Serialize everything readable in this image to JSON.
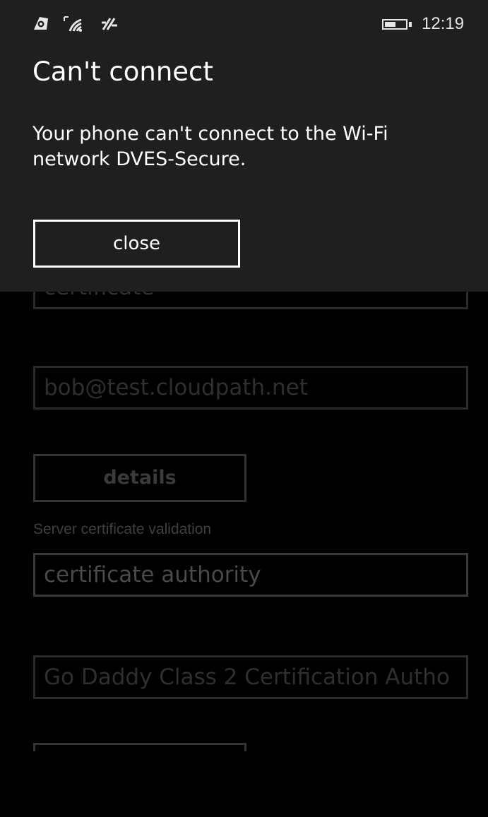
{
  "status_bar": {
    "icons": [
      "nfc-icon",
      "wifi-signal-icon",
      "data-sync-icon",
      "battery-icon"
    ],
    "battery_level": 0.55,
    "time": "12:19"
  },
  "dialog": {
    "title": "Can't connect",
    "message": "Your phone can't connect to the Wi-Fi network DVES-Secure.",
    "close_label": "close"
  },
  "background": {
    "field1_value": "certificate",
    "username_value": "bob@test.cloudpath.net",
    "details_label": "details",
    "server_validation_label": "Server certificate validation",
    "validation_value": "certificate authority",
    "authority_value": "Go Daddy Class 2 Certification Autho"
  },
  "colors": {
    "dialog_background": "#1f1f1f",
    "page_background": "#000000",
    "text": "#ffffff"
  }
}
